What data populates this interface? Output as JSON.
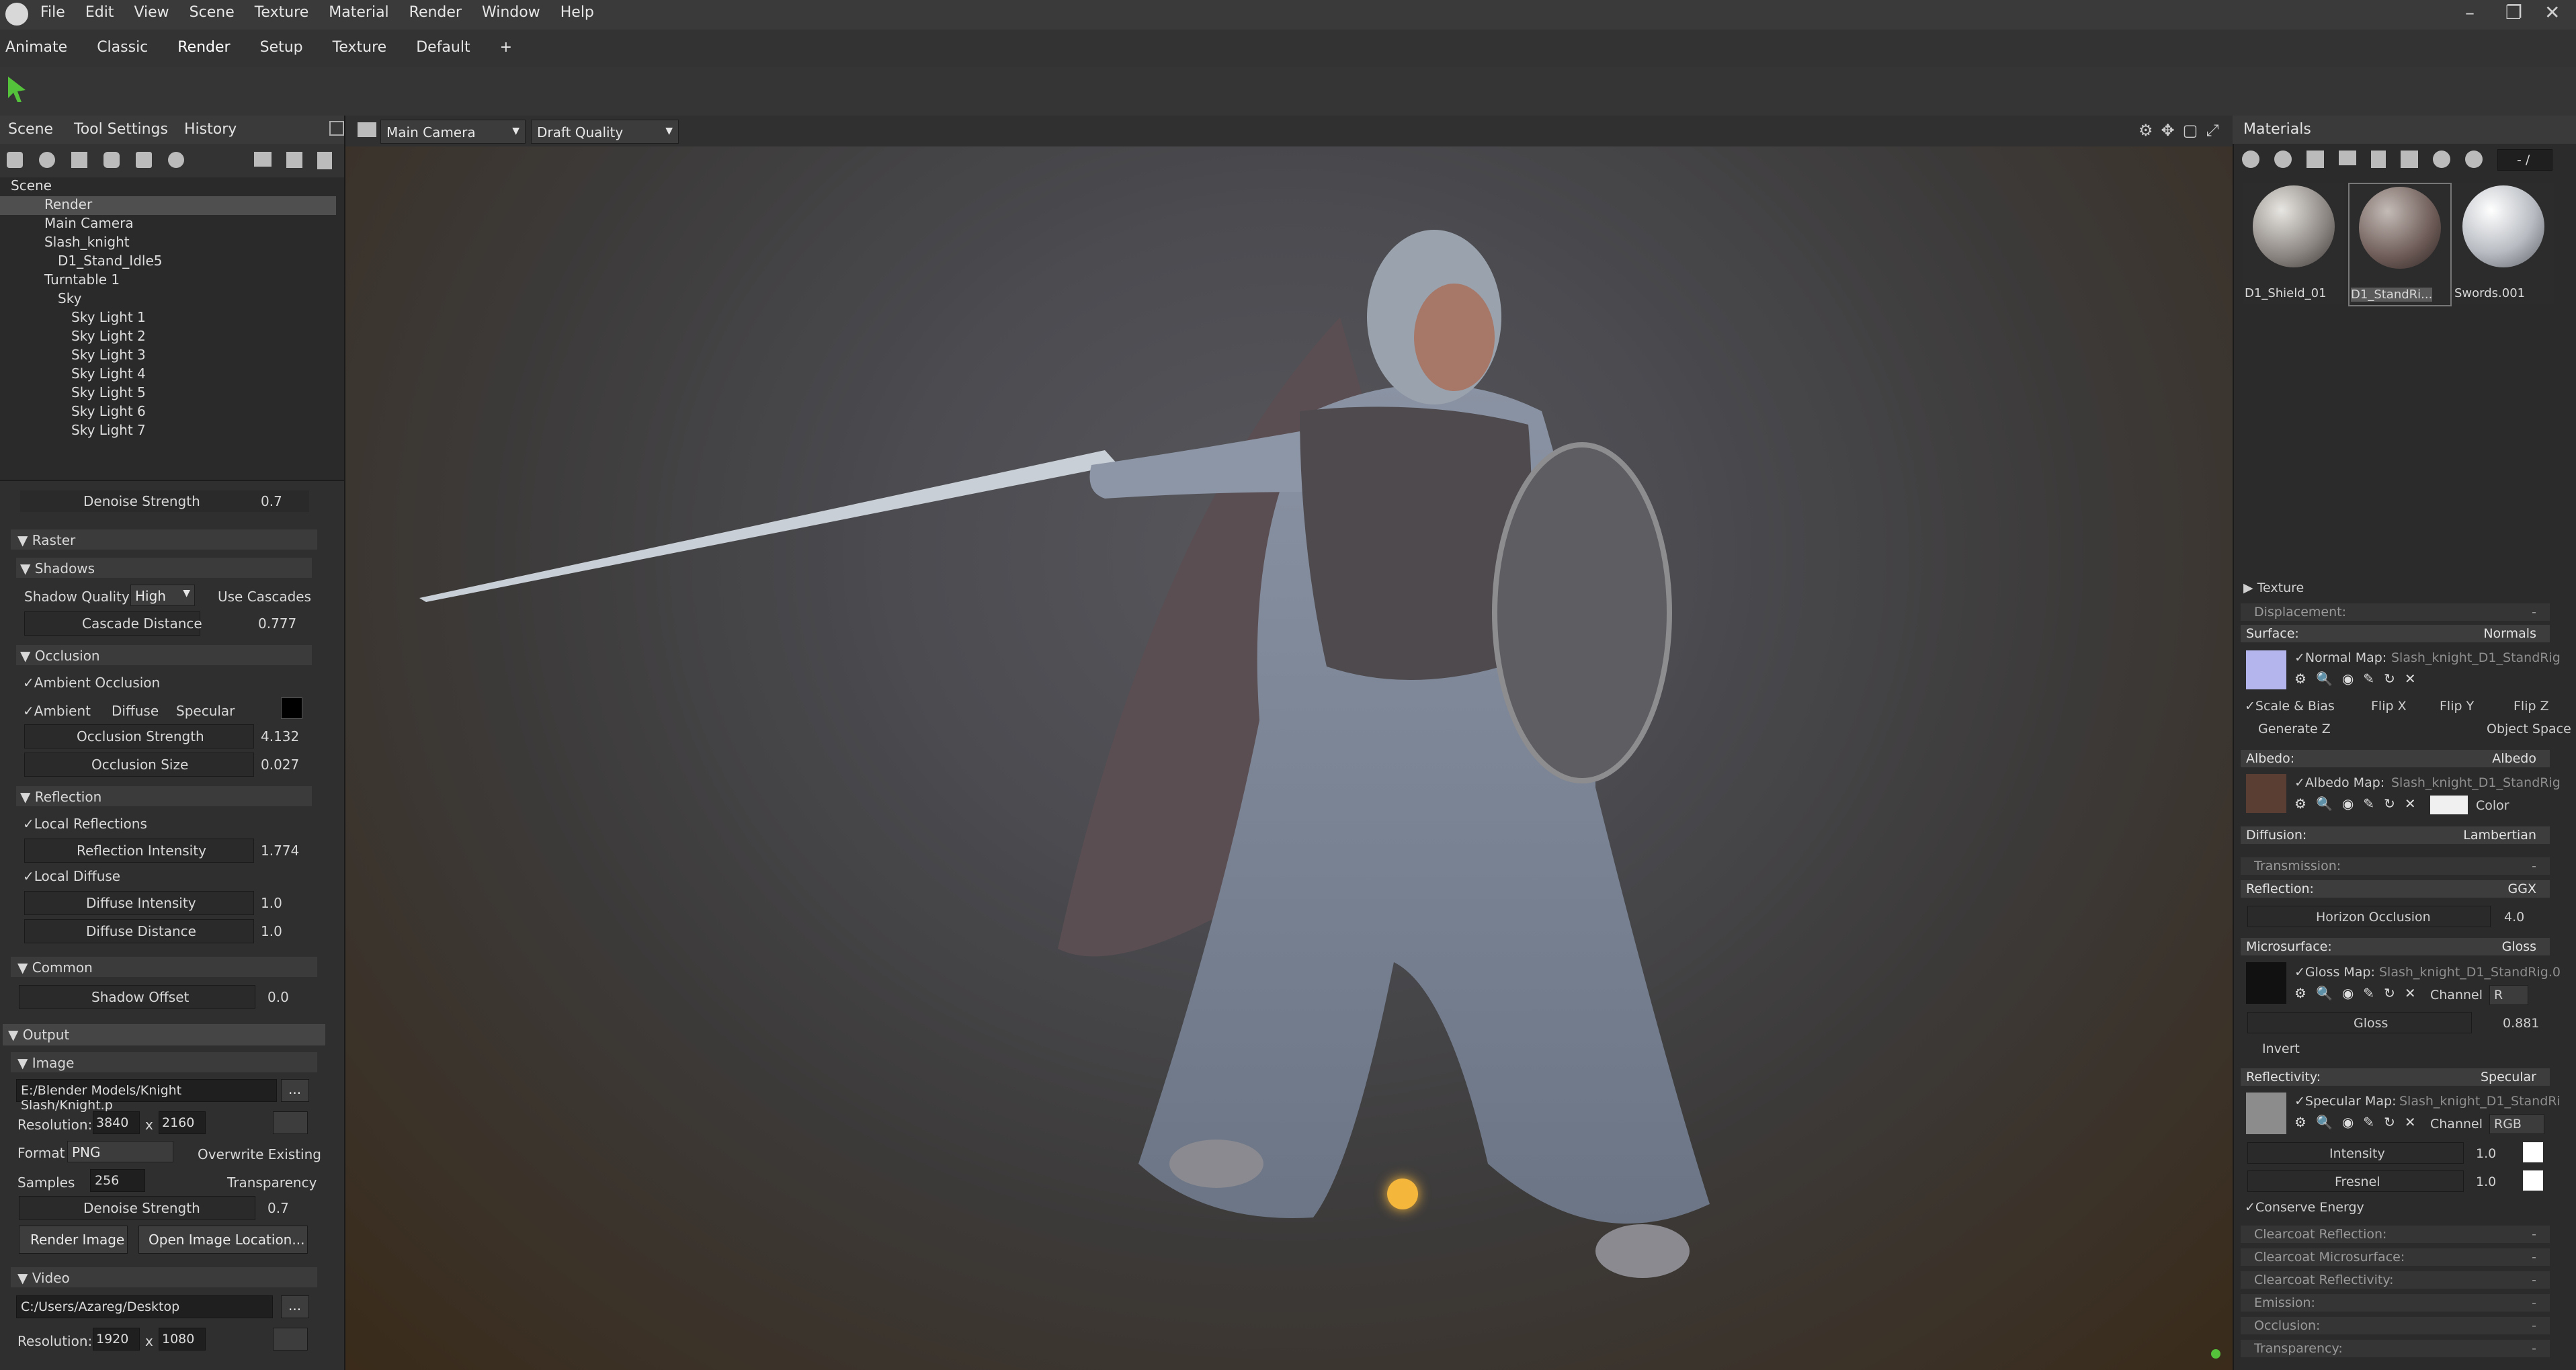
{
  "menubar": {
    "items": [
      "File",
      "Edit",
      "View",
      "Scene",
      "Texture",
      "Material",
      "Render",
      "Window",
      "Help"
    ]
  },
  "workspace_tabs": {
    "items": [
      "Animate",
      "Classic",
      "Render",
      "Setup",
      "Texture",
      "Default"
    ],
    "add": "+",
    "active": "Render"
  },
  "left_tabs": {
    "scene": "Scene",
    "tool_settings": "Tool Settings",
    "history": "History"
  },
  "outliner": {
    "items": [
      "Scene",
      "Render",
      "Main Camera",
      "Slash_knight",
      "D1_Stand_Idle5",
      "Turntable 1",
      "Sky",
      "Sky Light 1",
      "Sky Light 2",
      "Sky Light 3",
      "Sky Light 4",
      "Sky Light 5",
      "Sky Light 6",
      "Sky Light 7"
    ],
    "selected": "Render"
  },
  "render_settings": {
    "denoise_label": "Denoise Strength",
    "denoise_value": "0.7",
    "raster": "Raster",
    "shadows": "Shadows",
    "shadow_quality_label": "Shadow Quality",
    "shadow_quality_value": "High",
    "use_cascades": "Use Cascades",
    "cascade_distance_label": "Cascade Distance",
    "cascade_distance_value": "0.777",
    "occlusion": "Occlusion",
    "ambient_occlusion": "Ambient Occlusion",
    "ambient": "Ambient",
    "diffuse": "Diffuse",
    "specular": "Specular",
    "occlusion_strength_label": "Occlusion Strength",
    "occlusion_strength_value": "4.132",
    "occlusion_size_label": "Occlusion Size",
    "occlusion_size_value": "0.027",
    "reflection": "Reflection",
    "local_reflections": "Local Reflections",
    "reflection_intensity_label": "Reflection Intensity",
    "reflection_intensity_value": "1.774",
    "local_diffuse": "Local Diffuse",
    "diffuse_intensity_label": "Diffuse Intensity",
    "diffuse_intensity_value": "1.0",
    "diffuse_distance_label": "Diffuse Distance",
    "diffuse_distance_value": "1.0",
    "common": "Common",
    "shadow_offset_label": "Shadow Offset",
    "shadow_offset_value": "0.0"
  },
  "output": {
    "title": "Output",
    "image": "Image",
    "path": "E:/Blender Models/Knight Slash/Knight.p",
    "browse": "...",
    "resolution_label": "Resolution:",
    "res_w": "3840",
    "res_x": "x",
    "res_h": "2160",
    "format_label": "Format",
    "format_value": "PNG",
    "overwrite": "Overwrite Existing",
    "samples_label": "Samples",
    "samples_value": "256",
    "transparency": "Transparency",
    "denoise_label": "Denoise Strength",
    "denoise_value": "0.7",
    "render_image": "Render Image",
    "open_location": "Open Image Location...",
    "video": "Video",
    "video_path": "C:/Users/Azareg/Desktop",
    "video_res_label": "Resolution:",
    "video_res_w": "1920",
    "video_res_h": "1080"
  },
  "viewport": {
    "camera": "Main Camera",
    "quality": "Draft Quality"
  },
  "materials": {
    "title": "Materials",
    "count": "- /",
    "thumbs": [
      "D1_Shield_01",
      "D1_StandRi...",
      "Swords.001"
    ],
    "selected": "D1_StandRi...",
    "texture": "Texture",
    "displacement": "Displacement:",
    "displacement_val": "-",
    "surface": "Surface:",
    "surface_val": "Normals",
    "normal_map_label": "Normal Map:",
    "normal_map_file": "Slash_knight_D1_StandRig",
    "scale_bias": "Scale & Bias",
    "flip_x": "Flip X",
    "flip_y": "Flip Y",
    "flip_z": "Flip Z",
    "generate_z": "Generate Z",
    "object_space": "Object Space",
    "albedo": "Albedo:",
    "albedo_val": "Albedo",
    "albedo_map_label": "Albedo Map:",
    "albedo_map_file": "Slash_knight_D1_StandRig",
    "color": "Color",
    "diffusion": "Diffusion:",
    "diffusion_val": "Lambertian",
    "transmission": "Transmission:",
    "transmission_val": "-",
    "reflection": "Reflection:",
    "reflection_val": "GGX",
    "horizon_occlusion_label": "Horizon Occlusion",
    "horizon_occlusion_val": "4.0",
    "microsurface": "Microsurface:",
    "microsurface_val": "Gloss",
    "gloss_map_label": "Gloss Map:",
    "gloss_map_file": "Slash_knight_D1_StandRig.0",
    "channel_label": "Channel",
    "gloss_channel": "R",
    "gloss_label": "Gloss",
    "gloss_val": "0.881",
    "invert": "Invert",
    "reflectivity": "Reflectivity:",
    "reflectivity_val": "Specular",
    "specular_map_label": "Specular Map:",
    "specular_map_file": "Slash_knight_D1_StandRi",
    "spec_channel": "RGB",
    "intensity_label": "Intensity",
    "intensity_val": "1.0",
    "fresnel_label": "Fresnel",
    "fresnel_val": "1.0",
    "conserve_energy": "Conserve Energy",
    "clearcoat_reflection": "Clearcoat Reflection:",
    "clearcoat_microsurface": "Clearcoat Microsurface:",
    "clearcoat_reflectivity": "Clearcoat Reflectivity:",
    "emission": "Emission:",
    "occlusion": "Occlusion:",
    "transparency": "Transparency:",
    "dash": "-"
  },
  "colors": {
    "accent": "#55c23b",
    "selected_row": "#4f4f4f",
    "sun": "#f5b63c"
  }
}
